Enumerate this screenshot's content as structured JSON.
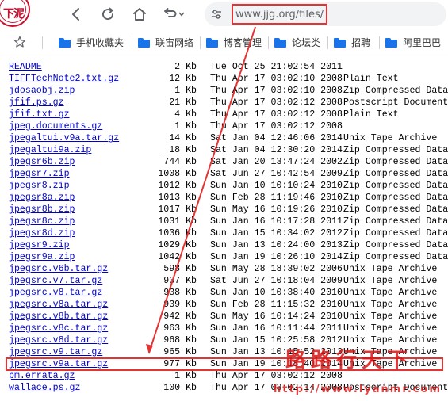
{
  "browser": {
    "logo_text": "下泥",
    "address_url": "www.jjg.org/files/",
    "icons": {
      "back": "chevron-left-icon",
      "reload": "reload-icon",
      "home": "home-icon",
      "undo": "undo-icon",
      "undo_menu": "chevron-down-icon",
      "site": "tune-icon",
      "bookmark_star": "star-icon"
    }
  },
  "bookmarks": [
    {
      "label": "手机收藏夹"
    },
    {
      "label": "联宙网络"
    },
    {
      "label": "博客管理"
    },
    {
      "label": "论坛类"
    },
    {
      "label": "招聘"
    },
    {
      "label": "阿里巴巴"
    }
  ],
  "files": [
    {
      "name": "README",
      "size": "2 Kb",
      "date": "Tue Oct 25 21:02:54 2011",
      "desc": ""
    },
    {
      "name": "TIFFTechNote2.txt.gz",
      "size": "12 Kb",
      "date": "Thu Apr 17 03:02:10 2008",
      "desc": "Plain Text"
    },
    {
      "name": "jdosaobj.zip",
      "size": "1 Kb",
      "date": "Thu Apr 17 03:02:10 2008",
      "desc": "Zip Compressed Data"
    },
    {
      "name": "jfif.ps.gz",
      "size": "21 Kb",
      "date": "Thu Apr 17 03:02:12 2008",
      "desc": "Postscript Document"
    },
    {
      "name": "jfif.txt.gz",
      "size": "4 Kb",
      "date": "Thu Apr 17 03:02:12 2008",
      "desc": "Plain Text"
    },
    {
      "name": "jpeg.documents.gz",
      "size": "1 Kb",
      "date": "Thu Apr 17 03:02:12 2008",
      "desc": ""
    },
    {
      "name": "jpegaltui.v9a.tar.gz",
      "size": "14 Kb",
      "date": "Sat Jan 04 12:46:06 2014",
      "desc": "Unix Tape Archive"
    },
    {
      "name": "jpegaltui9a.zip",
      "size": "18 Kb",
      "date": "Sat Jan 04 12:30:20 2014",
      "desc": "Zip Compressed Data"
    },
    {
      "name": "jpegsr6b.zip",
      "size": "744 Kb",
      "date": "Sat Jan 20 13:47:24 2002",
      "desc": "Zip Compressed Data"
    },
    {
      "name": "jpegsr7.zip",
      "size": "1008 Kb",
      "date": "Sat Jun 27 10:42:54 2009",
      "desc": "Zip Compressed Data"
    },
    {
      "name": "jpegsr8.zip",
      "size": "1012 Kb",
      "date": "Sun Jan 10 10:10:24 2010",
      "desc": "Zip Compressed Data"
    },
    {
      "name": "jpegsr8a.zip",
      "size": "1013 Kb",
      "date": "Sun Feb 28 11:19:46 2010",
      "desc": "Zip Compressed Data"
    },
    {
      "name": "jpegsr8b.zip",
      "size": "1017 Kb",
      "date": "Sun May 16 10:19:26 2010",
      "desc": "Zip Compressed Data"
    },
    {
      "name": "jpegsr8c.zip",
      "size": "1031 Kb",
      "date": "Sun Jan 16 10:17:28 2011",
      "desc": "Zip Compressed Data"
    },
    {
      "name": "jpegsr8d.zip",
      "size": "1036 Kb",
      "date": "Sun Jan 15 10:34:02 2012",
      "desc": "Zip Compressed Data"
    },
    {
      "name": "jpegsr9.zip",
      "size": "1029 Kb",
      "date": "Sun Jan 13 10:24:00 2013",
      "desc": "Zip Compressed Data"
    },
    {
      "name": "jpegsr9a.zip",
      "size": "1042 Kb",
      "date": "Sun Jan 19 10:26:10 2014",
      "desc": "Zip Compressed Data"
    },
    {
      "name": "jpegsrc.v6b.tar.gz",
      "size": "598 Kb",
      "date": "Sun May 28 18:39:02 2006",
      "desc": "Unix Tape Archive"
    },
    {
      "name": "jpegsrc.v7.tar.gz",
      "size": "937 Kb",
      "date": "Sat Jun 27 10:18:04 2009",
      "desc": "Unix Tape Archive"
    },
    {
      "name": "jpegsrc.v8.tar.gz",
      "size": "938 Kb",
      "date": "Sun Jan 10 10:38:40 2010",
      "desc": "Unix Tape Archive"
    },
    {
      "name": "jpegsrc.v8a.tar.gz",
      "size": "939 Kb",
      "date": "Sun Feb 28 11:15:32 2010",
      "desc": "Unix Tape Archive"
    },
    {
      "name": "jpegsrc.v8b.tar.gz",
      "size": "942 Kb",
      "date": "Sun May 16 10:14:24 2010",
      "desc": "Unix Tape Archive"
    },
    {
      "name": "jpegsrc.v8c.tar.gz",
      "size": "963 Kb",
      "date": "Sun Jan 16 10:11:44 2011",
      "desc": "Unix Tape Archive"
    },
    {
      "name": "jpegsrc.v8d.tar.gz",
      "size": "968 Kb",
      "date": "Sun Jan 15 10:25:58 2012",
      "desc": "Unix Tape Archive"
    },
    {
      "name": "jpegsrc.v9.tar.gz",
      "size": "965 Kb",
      "date": "Sun Jan 13 10:15:52 2013",
      "desc": "Unix Tape Archive"
    },
    {
      "name": "jpegsrc.v9a.tar.gz",
      "size": "977 Kb",
      "date": "Sun Jan 19 10:18:40 2014",
      "desc": "Unix Tape Archive"
    },
    {
      "name": "pm.errata.gz",
      "size": "1 Kb",
      "date": "Thu Apr 17 03:02:12 2008",
      "desc": ""
    },
    {
      "name": "wallace.ps.gz",
      "size": "100 Kb",
      "date": "Thu Apr 17 03:02:14 2008",
      "desc": "Postscript Document"
    }
  ],
  "annotation": {
    "highlight_color": "#e53333",
    "watermark_text": "路路行天下",
    "watermark_url": "http://www.lyanmr.com"
  }
}
